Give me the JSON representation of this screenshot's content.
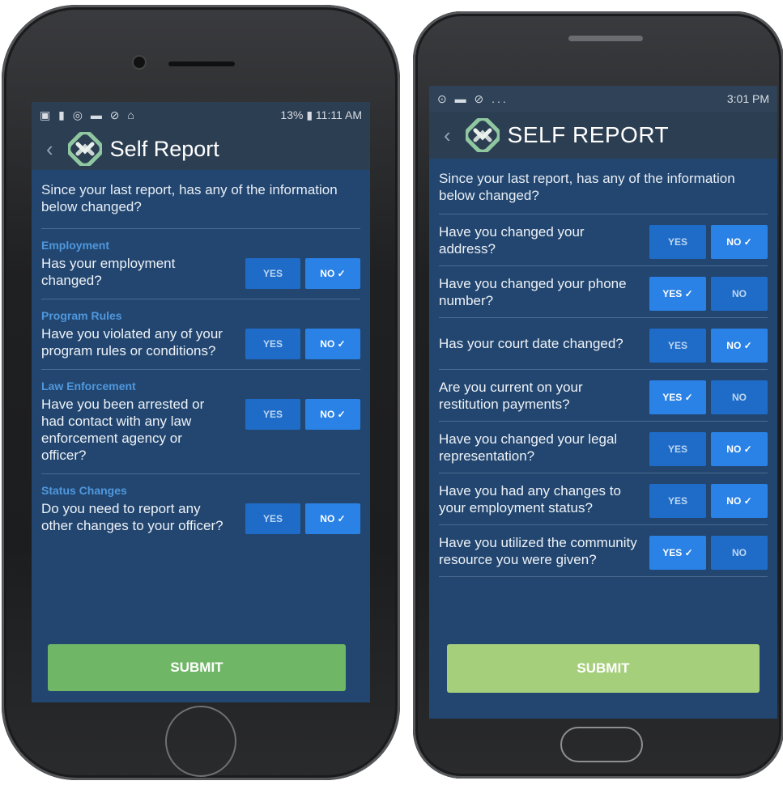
{
  "left_phone": {
    "status_bar": {
      "left_icons": "▣ ▮ ◎ ▬ ⊘ ⌂",
      "right_text": "13% ▮ 11:11 AM"
    },
    "header": {
      "back": "‹",
      "title": "Self Report"
    },
    "intro": "Since your last report, has any of the information below changed?",
    "sections": [
      {
        "label": "Employment",
        "question": "Has your employment changed?",
        "yes": "YES",
        "no": "NO ✓",
        "selected": "no"
      },
      {
        "label": "Program Rules",
        "question": "Have you violated any of your program rules or conditions?",
        "yes": "YES",
        "no": "NO ✓",
        "selected": "no"
      },
      {
        "label": "Law Enforcement",
        "question": "Have you been arrested or had contact with any law enforcement agency or officer?",
        "yes": "YES",
        "no": "NO ✓",
        "selected": "no"
      },
      {
        "label": "Status Changes",
        "question": "Do you need to report any other changes to your officer?",
        "yes": "YES",
        "no": "NO ✓",
        "selected": "no"
      }
    ],
    "submit": "SUBMIT"
  },
  "right_phone": {
    "status_bar": {
      "left_icons": "⊙ ▬ ⊘ ...",
      "right_text": "3:01 PM"
    },
    "header": {
      "back": "‹",
      "title": "SELF REPORT"
    },
    "intro": "Since your last report, has any of the information below changed?",
    "questions": [
      {
        "question": "Have you changed your address?",
        "yes": "YES",
        "no": "NO ✓",
        "selected": "no"
      },
      {
        "question": "Have you changed your phone number?",
        "yes": "YES ✓",
        "no": "NO",
        "selected": "yes"
      },
      {
        "question": "Has your court date changed?",
        "yes": "YES",
        "no": "NO ✓",
        "selected": "no"
      },
      {
        "question": "Are you current on your restitution payments?",
        "yes": "YES ✓",
        "no": "NO",
        "selected": "yes"
      },
      {
        "question": "Have you changed your legal representation?",
        "yes": "YES",
        "no": "NO ✓",
        "selected": "no"
      },
      {
        "question": "Have you had any changes to your employment status?",
        "yes": "YES",
        "no": "NO ✓",
        "selected": "no"
      },
      {
        "question": "Have you utilized the community resource you were given?",
        "yes": "YES ✓",
        "no": "NO",
        "selected": "yes"
      }
    ],
    "submit": "SUBMIT"
  },
  "colors": {
    "screen_bg": "#22466f",
    "header_bg": "#2c3e52",
    "button": "#1f6cc8",
    "section_label": "#4f98de",
    "submit_left": "#6fb766",
    "submit_right": "#a6cf7c"
  },
  "icons": {
    "logo": "self-report-logo-icon",
    "back": "back-chevron-icon"
  }
}
